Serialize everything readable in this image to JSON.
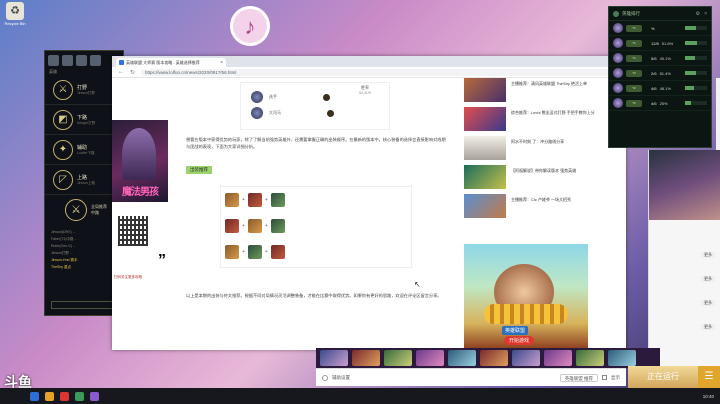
{
  "desktop": {
    "icon_label": "Recycle Bin"
  },
  "client": {
    "tabs": "英雄",
    "roles": [
      {
        "label": "打野",
        "sub": "Jinwon打野"
      },
      {
        "label": "下路",
        "sub": "Krieger打野"
      },
      {
        "label": "辅助",
        "sub": "Lucifer下路"
      },
      {
        "label": "上路",
        "sub": "Jinwon上路"
      }
    ],
    "global_title": "全局推荐",
    "global_sub": "中路",
    "notes": [
      "Jinwon(DRX) ...",
      "Faker(T1)中路 ...",
      "Ruler(Gen.G) ...",
      "Jinwon打野 ...",
      "Jinwon-Hnd 赛手",
      "TheShy 重点"
    ],
    "footer_btn": ""
  },
  "poster": {
    "title": "魔法男孩"
  },
  "qr": {
    "caption": "扫码关注更多攻略",
    "quote_mark": "”"
  },
  "browser": {
    "tab_title": "英雄联盟 大师赛 版本攻略 - 英雄选择推荐",
    "url": "https://www.lolfun.cn/news/2020/0917/56.html",
    "nav_back": "←",
    "nav_reload": "↻"
  },
  "article": {
    "pick_header": "胜率",
    "pick_pct": "52.41%",
    "picks": [
      "选手",
      "大司马"
    ],
    "para1": "想要在版本中获得优势的玩家，除了了解当前强势英雄外，还需要掌握正确的出装顺序。在最新的版本中，核心装备的选择会直接影响对线期与团战的表现，下面为大家详细分析。",
    "highlight": "出装推荐",
    "para2": "以上是本期的出装与符文推荐。根据不同对局情况灵活调整装备，才能在比赛中取得优势。如果你有更好的思路，欢迎在评论区留言分享。"
  },
  "news": [
    {
      "text": "主播推荐：清风英雄联盟 TheShy 绝活上单"
    },
    {
      "text": "综合推荐：Lechi 熊出没式打野 手把手教你上分"
    },
    {
      "text": "阿水不时刻 了：冲分路线分享"
    },
    {
      "text": "【阿祖解说】带你解读版本 强势英雄"
    },
    {
      "text": "主播推荐：Clc 卢姥爷 一场大招秀"
    }
  ],
  "bigad": {
    "logo": "英雄联盟",
    "button": "开始游戏"
  },
  "rank": {
    "title": "英雄排行",
    "rows": [
      {
        "tier": "T1",
        "value": "%",
        "pct": "",
        "fill": 0.5
      },
      {
        "tier": "T1",
        "value": "12/8",
        "pct": "51.6%",
        "fill": 0.55
      },
      {
        "tier": "T1",
        "value": "5/6",
        "pct": "49.1%",
        "fill": 0.45
      },
      {
        "tier": "T2",
        "value": "2/6",
        "pct": "51.4%",
        "fill": 0.52
      },
      {
        "tier": "T2",
        "value": "4/6",
        "pct": "48.1%",
        "fill": 0.43
      },
      {
        "tier": "T2",
        "value": "4/6",
        "pct": "25%",
        "fill": 0.25
      }
    ]
  },
  "rside": {
    "lines": [
      {
        "left": "",
        "right": "更多"
      },
      {
        "left": "",
        "right": "更多"
      },
      {
        "left": "",
        "right": "更多"
      },
      {
        "left": "",
        "right": "更多"
      }
    ]
  },
  "bottom": {
    "auto_label": "辅助设置",
    "select_value": "英雄联盟 推荐",
    "checkbox_label": "显示"
  },
  "start_button": "正在运行",
  "douyu_logo": "斗鱼",
  "clock": "10:40"
}
